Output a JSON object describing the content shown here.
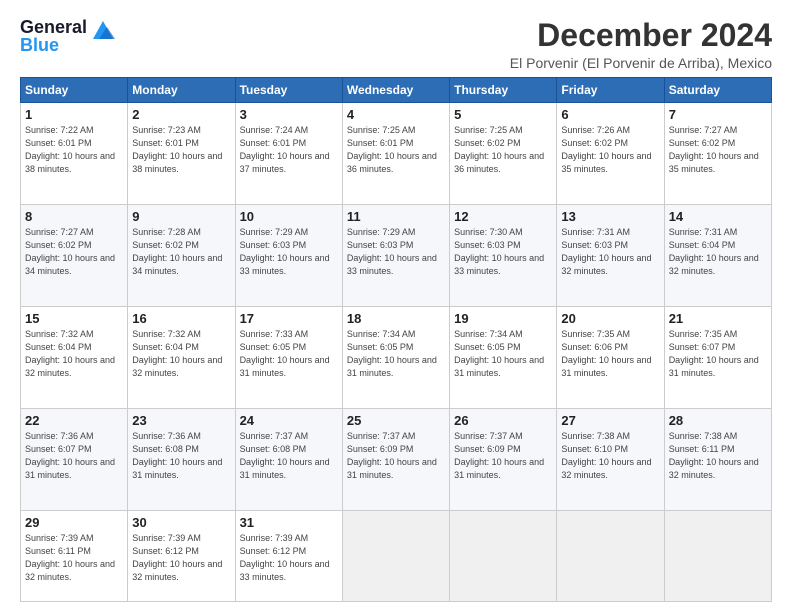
{
  "header": {
    "logo_line1": "General",
    "logo_line2": "Blue",
    "main_title": "December 2024",
    "sub_title": "El Porvenir (El Porvenir de Arriba), Mexico"
  },
  "calendar": {
    "days_of_week": [
      "Sunday",
      "Monday",
      "Tuesday",
      "Wednesday",
      "Thursday",
      "Friday",
      "Saturday"
    ],
    "weeks": [
      [
        null,
        {
          "day": 2,
          "sr": "7:23 AM",
          "ss": "6:01 PM",
          "dl": "10 hours and 38 minutes."
        },
        {
          "day": 3,
          "sr": "7:24 AM",
          "ss": "6:01 PM",
          "dl": "10 hours and 37 minutes."
        },
        {
          "day": 4,
          "sr": "7:25 AM",
          "ss": "6:01 PM",
          "dl": "10 hours and 36 minutes."
        },
        {
          "day": 5,
          "sr": "7:25 AM",
          "ss": "6:02 PM",
          "dl": "10 hours and 36 minutes."
        },
        {
          "day": 6,
          "sr": "7:26 AM",
          "ss": "6:02 PM",
          "dl": "10 hours and 35 minutes."
        },
        {
          "day": 7,
          "sr": "7:27 AM",
          "ss": "6:02 PM",
          "dl": "10 hours and 35 minutes."
        }
      ],
      [
        {
          "day": 1,
          "sr": "7:22 AM",
          "ss": "6:01 PM",
          "dl": "10 hours and 38 minutes."
        },
        {
          "day": 8,
          "sr": "7:27 AM",
          "ss": "6:02 PM",
          "dl": "10 hours and 34 minutes."
        },
        {
          "day": 9,
          "sr": "7:28 AM",
          "ss": "6:02 PM",
          "dl": "10 hours and 34 minutes."
        },
        {
          "day": 10,
          "sr": "7:29 AM",
          "ss": "6:03 PM",
          "dl": "10 hours and 33 minutes."
        },
        {
          "day": 11,
          "sr": "7:29 AM",
          "ss": "6:03 PM",
          "dl": "10 hours and 33 minutes."
        },
        {
          "day": 12,
          "sr": "7:30 AM",
          "ss": "6:03 PM",
          "dl": "10 hours and 33 minutes."
        },
        {
          "day": 13,
          "sr": "7:31 AM",
          "ss": "6:03 PM",
          "dl": "10 hours and 32 minutes."
        },
        {
          "day": 14,
          "sr": "7:31 AM",
          "ss": "6:04 PM",
          "dl": "10 hours and 32 minutes."
        }
      ],
      [
        {
          "day": 15,
          "sr": "7:32 AM",
          "ss": "6:04 PM",
          "dl": "10 hours and 32 minutes."
        },
        {
          "day": 16,
          "sr": "7:32 AM",
          "ss": "6:04 PM",
          "dl": "10 hours and 32 minutes."
        },
        {
          "day": 17,
          "sr": "7:33 AM",
          "ss": "6:05 PM",
          "dl": "10 hours and 31 minutes."
        },
        {
          "day": 18,
          "sr": "7:34 AM",
          "ss": "6:05 PM",
          "dl": "10 hours and 31 minutes."
        },
        {
          "day": 19,
          "sr": "7:34 AM",
          "ss": "6:05 PM",
          "dl": "10 hours and 31 minutes."
        },
        {
          "day": 20,
          "sr": "7:35 AM",
          "ss": "6:06 PM",
          "dl": "10 hours and 31 minutes."
        },
        {
          "day": 21,
          "sr": "7:35 AM",
          "ss": "6:07 PM",
          "dl": "10 hours and 31 minutes."
        }
      ],
      [
        {
          "day": 22,
          "sr": "7:36 AM",
          "ss": "6:07 PM",
          "dl": "10 hours and 31 minutes."
        },
        {
          "day": 23,
          "sr": "7:36 AM",
          "ss": "6:08 PM",
          "dl": "10 hours and 31 minutes."
        },
        {
          "day": 24,
          "sr": "7:37 AM",
          "ss": "6:08 PM",
          "dl": "10 hours and 31 minutes."
        },
        {
          "day": 25,
          "sr": "7:37 AM",
          "ss": "6:09 PM",
          "dl": "10 hours and 31 minutes."
        },
        {
          "day": 26,
          "sr": "7:37 AM",
          "ss": "6:09 PM",
          "dl": "10 hours and 31 minutes."
        },
        {
          "day": 27,
          "sr": "7:38 AM",
          "ss": "6:10 PM",
          "dl": "10 hours and 32 minutes."
        },
        {
          "day": 28,
          "sr": "7:38 AM",
          "ss": "6:11 PM",
          "dl": "10 hours and 32 minutes."
        }
      ],
      [
        {
          "day": 29,
          "sr": "7:39 AM",
          "ss": "6:11 PM",
          "dl": "10 hours and 32 minutes."
        },
        {
          "day": 30,
          "sr": "7:39 AM",
          "ss": "6:12 PM",
          "dl": "10 hours and 32 minutes."
        },
        {
          "day": 31,
          "sr": "7:39 AM",
          "ss": "6:12 PM",
          "dl": "10 hours and 33 minutes."
        },
        null,
        null,
        null,
        null
      ]
    ]
  }
}
